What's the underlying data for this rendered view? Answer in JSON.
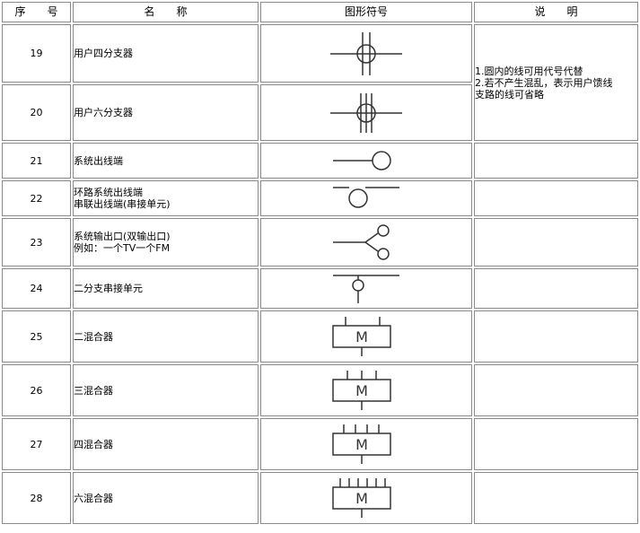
{
  "headers": {
    "no": "序　　号",
    "name": "名　　称",
    "symbol": "图形符号",
    "desc": "说　　明"
  },
  "rows": [
    {
      "no": "19",
      "name": [
        "用户四分支器"
      ],
      "icon": "user-four-way-tap-icon"
    },
    {
      "no": "20",
      "name": [
        "用户六分支器"
      ],
      "icon": "user-six-way-tap-icon"
    },
    {
      "no": "21",
      "name": [
        "系统出线端"
      ],
      "icon": "system-outlet-end-icon"
    },
    {
      "no": "22",
      "name": [
        "环路系统出线端",
        "串联出线端(串接单元)"
      ],
      "icon": "loop-outlet-end-icon"
    },
    {
      "no": "23",
      "name": [
        "系统输出口(双输出口)",
        "例如：一个TV一个FM"
      ],
      "icon": "dual-output-port-icon"
    },
    {
      "no": "24",
      "name": [
        "二分支串接单元"
      ],
      "icon": "two-way-series-unit-icon"
    },
    {
      "no": "25",
      "name": [
        "二混合器"
      ],
      "icon": "two-input-mixer-icon"
    },
    {
      "no": "26",
      "name": [
        "三混合器"
      ],
      "icon": "three-input-mixer-icon"
    },
    {
      "no": "27",
      "name": [
        "四混合器"
      ],
      "icon": "four-input-mixer-icon"
    },
    {
      "no": "28",
      "name": [
        "六混合器"
      ],
      "icon": "six-input-mixer-icon"
    }
  ],
  "note": [
    "1.圆内的线可用代号代替",
    "2.若不产生混乱，表示用户馈线",
    "支路的线可省略"
  ],
  "mixer_letter": "M"
}
